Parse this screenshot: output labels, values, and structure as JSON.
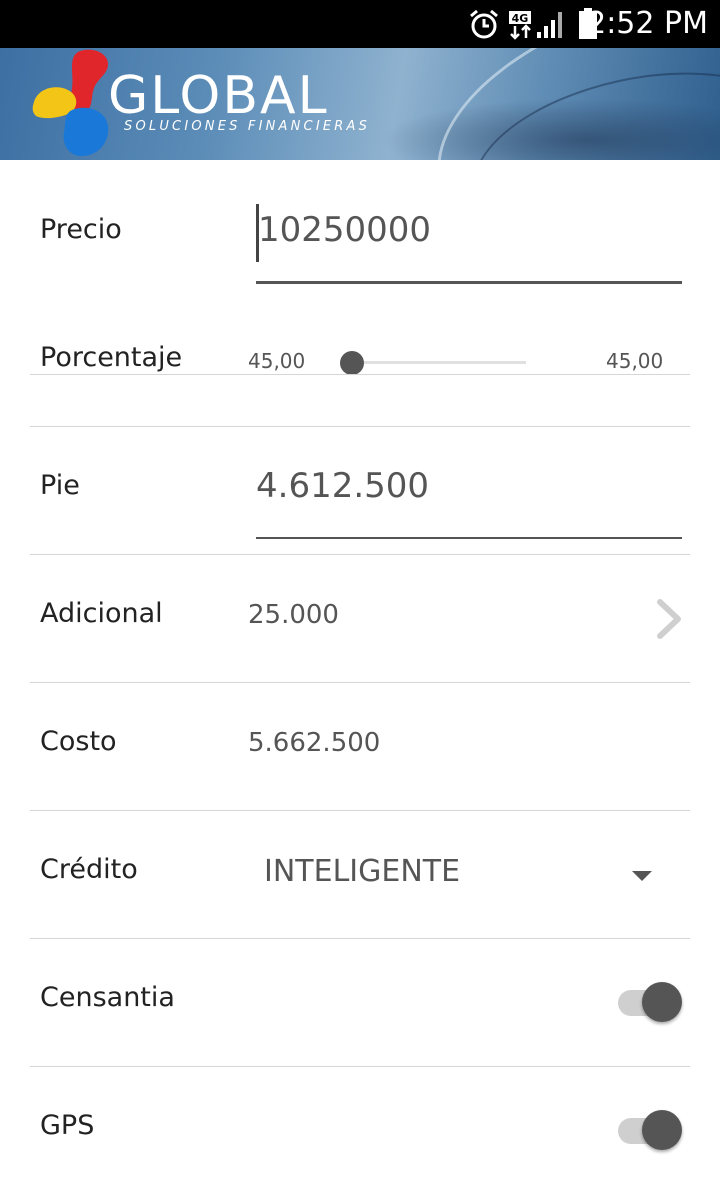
{
  "status_bar": {
    "time": "2:52 PM",
    "network": "4G",
    "icons": [
      "alarm-icon",
      "network-4g-icon",
      "signal-icon",
      "battery-icon"
    ]
  },
  "banner": {
    "brand": "GLOBAL",
    "tagline": "SOLUCIONES FINANCIERAS",
    "colors": {
      "red": "#e0262a",
      "yellow": "#f3c516",
      "blue": "#1a78d8"
    }
  },
  "form": {
    "precio": {
      "label": "Precio",
      "value": "10250000"
    },
    "porcentaje": {
      "label": "Porcentaje",
      "min_text": "45,00",
      "max_text": "45,00",
      "position": 0.0
    },
    "pie": {
      "label": "Pie",
      "value": "4.612.500"
    },
    "adicional": {
      "label": "Adicional",
      "value": "25.000"
    },
    "costo": {
      "label": "Costo",
      "value": "5.662.500"
    },
    "credito": {
      "label": "Crédito",
      "selected": "INTELIGENTE"
    },
    "censantia": {
      "label": "Censantia",
      "checked": true
    },
    "gps": {
      "label": "GPS",
      "checked": true
    }
  }
}
